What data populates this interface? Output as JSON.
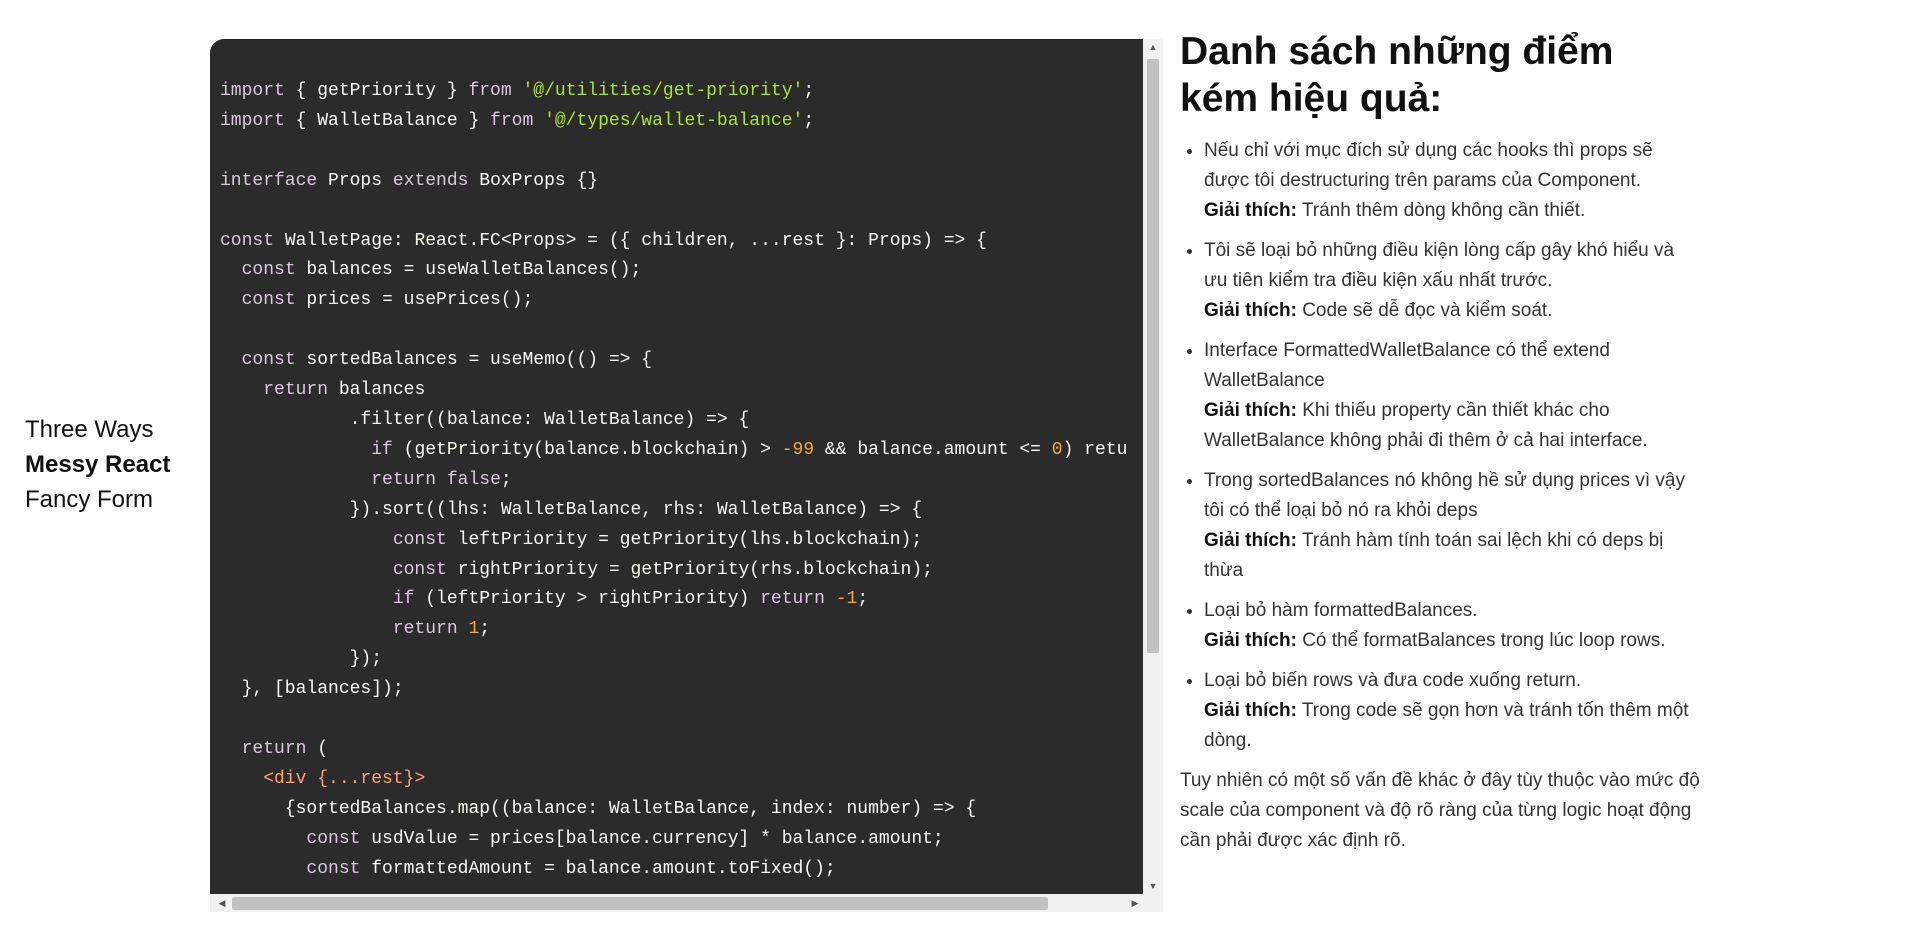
{
  "sidebar": {
    "items": [
      {
        "label": "Three Ways",
        "active": false
      },
      {
        "label": "Messy React",
        "active": true
      },
      {
        "label": "Fancy Form",
        "active": false
      }
    ]
  },
  "code": {
    "lines": [
      "import { getPriority } from '@/utilities/get-priority';",
      "import { WalletBalance } from '@/types/wallet-balance';",
      "",
      "interface Props extends BoxProps {}",
      "",
      "const WalletPage: React.FC<Props> = ({ children, ...rest }: Props) => {",
      "  const balances = useWalletBalances();",
      "  const prices = usePrices();",
      "",
      "  const sortedBalances = useMemo(() => {",
      "    return balances",
      "            .filter((balance: WalletBalance) => {",
      "              if (getPriority(balance.blockchain) > -99 && balance.amount <= 0) retu",
      "              return false;",
      "            }).sort((lhs: WalletBalance, rhs: WalletBalance) => {",
      "                const leftPriority = getPriority(lhs.blockchain);",
      "                const rightPriority = getPriority(rhs.blockchain);",
      "                if (leftPriority > rightPriority) return -1;",
      "                return 1;",
      "            });",
      "  }, [balances]);",
      "",
      "  return (",
      "    <div {...rest}>",
      "      {sortedBalances.map((balance: WalletBalance, index: number) => {",
      "        const usdValue = prices[balance.currency] * balance.amount;",
      "        const formattedAmount = balance.amount.toFixed();"
    ]
  },
  "notes": {
    "heading": "Danh sách những điểm kém hiệu quả:",
    "explain_label": "Giải thích:",
    "items": [
      {
        "point": "Nếu chỉ với mục đích sử dụng các hooks thì props sẽ được tôi destructuring trên params của Component.",
        "explanation": "Tránh thêm dòng không cần thiết."
      },
      {
        "point": "Tôi sẽ loại bỏ những điều kiện lòng cấp gây khó hiểu và ưu tiên kiểm tra điều kiện xấu nhất trước.",
        "explanation": "Code sẽ dễ đọc và kiểm soát."
      },
      {
        "point": "Interface FormattedWalletBalance có thể extend WalletBalance",
        "explanation": "Khi thiếu property cần thiết khác cho WalletBalance không phải đi thêm ở cả hai interface."
      },
      {
        "point": "Trong sortedBalances nó không hề sử dụng prices vì vậy tôi có thể loại bỏ nó ra khỏi deps",
        "explanation": "Tránh hàm tính toán sai lệch khi có deps bị thừa"
      },
      {
        "point": "Loại bỏ hàm formattedBalances.",
        "explanation": "Có thể formatBalances trong lúc loop rows."
      },
      {
        "point": "Loại bỏ biến rows và đưa code xuống return.",
        "explanation": "Trong code sẽ gọn hơn và tránh tốn thêm một dòng."
      }
    ],
    "closing": "Tuy nhiên có một số vấn đề khác ở đây tùy thuộc vào mức độ scale của component và độ rõ ràng của từng logic hoạt động cần phải được xác định rõ."
  },
  "icons": {
    "scroll_up": "triangle-up-icon",
    "scroll_down": "triangle-down-icon",
    "scroll_left": "triangle-left-icon",
    "scroll_right": "triangle-right-icon"
  },
  "colors": {
    "code_background": "#2b2b2b",
    "code_text": "#f8f8f2",
    "keyword": "#dcc6e0",
    "string": "#abe338",
    "number": "#f5ab35",
    "jsx_tag": "#ffa07a"
  }
}
